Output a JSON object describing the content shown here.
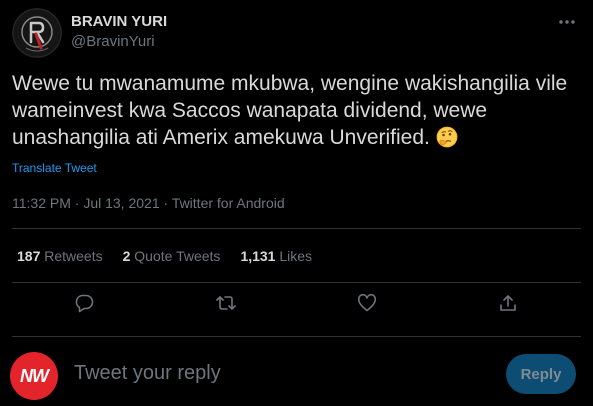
{
  "author": {
    "display_name": "BRAVIN YURI",
    "handle": "@BravinYuri"
  },
  "tweet": {
    "text": "Wewe tu mwanamume mkubwa, wengine wakishangilia vile wameinvest kwa Saccos wanapata dividend, wewe unashangilia ati Amerix amekuwa Unverified.",
    "emoji": "thinking-face-emoji",
    "translate_label": "Translate Tweet",
    "meta": "11:32 PM · Jul 13, 2021 · Twitter for Android"
  },
  "stats": {
    "retweets_count": "187",
    "retweets_label": "Retweets",
    "quotes_count": "2",
    "quotes_label": "Quote Tweets",
    "likes_count": "1,131",
    "likes_label": "Likes"
  },
  "actions": [
    "reply-icon",
    "retweet-icon",
    "like-icon",
    "share-icon"
  ],
  "reply": {
    "avatar_text": "NW",
    "placeholder": "Tweet your reply",
    "button_label": "Reply"
  },
  "colors": {
    "background": "#000000",
    "text": "#d9d9d9",
    "muted": "#6e767d",
    "link": "#1d9bf0",
    "reply_button": "#0e4d73",
    "reply_avatar": "#e3242b"
  }
}
